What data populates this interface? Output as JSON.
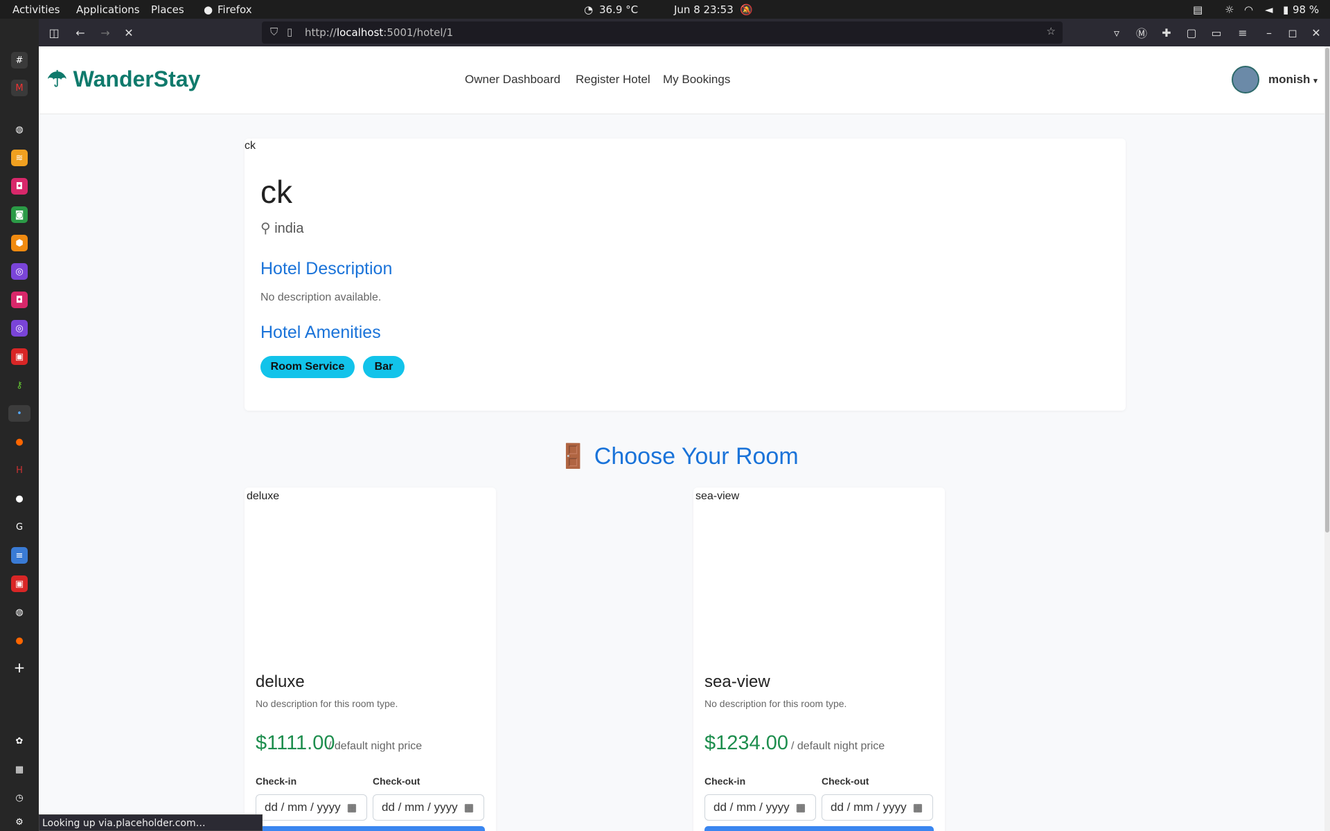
{
  "topbar": {
    "activities": "Activities",
    "applications": "Applications",
    "places": "Places",
    "firefox": "Firefox",
    "temp": "36.9 °C",
    "datetime": "Jun 8  23:53",
    "battery": "98 %"
  },
  "browser": {
    "url_prefix": "http://",
    "url_host": "localhost",
    "url_rest": ":5001/hotel/1"
  },
  "site": {
    "logo": "WanderStay",
    "nav": {
      "owner": "Owner Dashboard",
      "register": "Register Hotel",
      "bookings": "My Bookings"
    },
    "user": "monish"
  },
  "hotel": {
    "img_alt": "ck",
    "name": "ck",
    "location": "india",
    "desc_heading": "Hotel Description",
    "description": "No description available.",
    "amen_heading": "Hotel Amenities",
    "amenities": [
      "Room Service",
      "Bar"
    ]
  },
  "rooms_heading": "Choose Your Room",
  "rooms": [
    {
      "img_alt": "deluxe",
      "name": "deluxe",
      "desc": "No description for this room type.",
      "price": "$1111.00",
      "price_suffix": "/ default night price",
      "checkin": "Check-in",
      "checkout": "Check-out",
      "placeholder": "dd / mm / yyyy"
    },
    {
      "img_alt": "sea-view",
      "name": "sea-view",
      "desc": "No description for this room type.",
      "price": "$1234.00",
      "price_suffix": "/ default night price",
      "checkin": "Check-in",
      "checkout": "Check-out",
      "placeholder": "dd / mm / yyyy"
    }
  ],
  "status_text": "Looking up via.placeholder.com…",
  "colors": {
    "brand": "#0f7a6c",
    "heading": "#1a73d9",
    "price": "#1e8e4e",
    "pill": "#12c3ea"
  }
}
